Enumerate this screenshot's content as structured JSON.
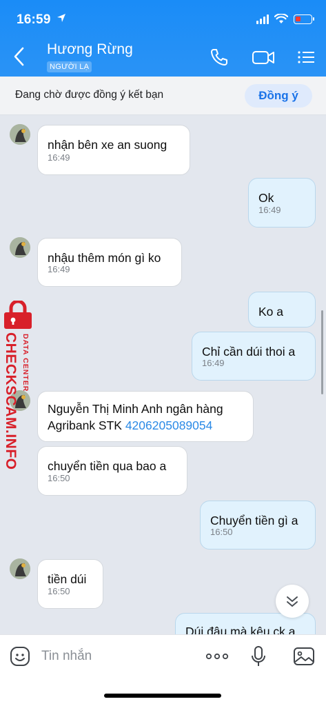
{
  "status": {
    "time": "16:59"
  },
  "header": {
    "title": "Hương Rừng",
    "badge": "NGƯỜI LẠ"
  },
  "request": {
    "text": "Đang chờ được đồng ý kết bạn",
    "accept": "Đồng ý"
  },
  "messages": [
    {
      "text": "nhận bên xe an suong",
      "time": "16:49"
    },
    {
      "text": "Ok",
      "time": "16:49"
    },
    {
      "text": "nhậu thêm món gì ko",
      "time": "16:49"
    },
    {
      "text": "Ko a"
    },
    {
      "text": "Chỉ cần dúi thoi a",
      "time": "16:49"
    },
    {
      "line1": "Nguyễn Thị Minh Anh ngân hàng",
      "line2": "Agribank STK ",
      "account": "4206205089054"
    },
    {
      "text": "chuyển tiền qua bao a",
      "time": "16:50"
    },
    {
      "text": "Chuyển tiền gì a",
      "time": "16:50"
    },
    {
      "text": "tiền dúi",
      "time": "16:50"
    },
    {
      "text": "Dúi đâu mà kêu ck a"
    }
  ],
  "watermark": {
    "small": "DATA CENTER",
    "large": "CHECKSCAM.INFO"
  },
  "input": {
    "placeholder": "Tin nhắn"
  }
}
